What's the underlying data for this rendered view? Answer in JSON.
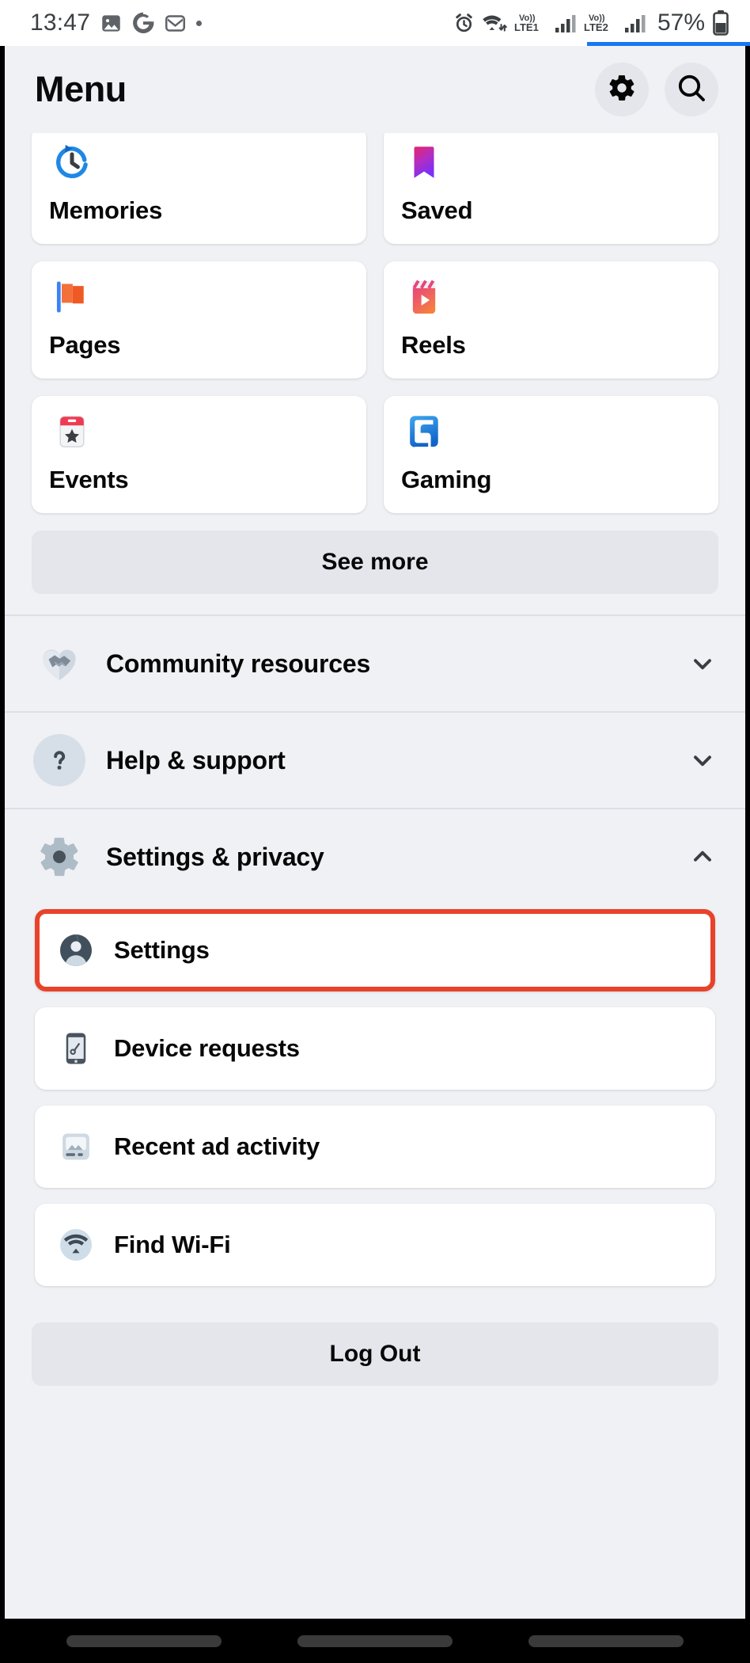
{
  "status_bar": {
    "time": "13:47",
    "left_icons": [
      "photos-icon",
      "google-icon",
      "gmail-icon",
      "dot-icon"
    ],
    "right_icons": [
      "alarm-icon",
      "wifi-icon",
      "volte1-icon",
      "signal1-icon",
      "volte2-icon",
      "signal2-icon"
    ],
    "volte1_label_top": "Vo))",
    "volte1_label_bottom": "LTE1",
    "volte2_label_top": "Vo))",
    "volte2_label_bottom": "LTE2",
    "battery_percent": "57%"
  },
  "header": {
    "title": "Menu",
    "settings_icon": "gear-icon",
    "search_icon": "search-icon"
  },
  "shortcuts": {
    "tiles": [
      {
        "label": "Memories",
        "icon": "memories-clock-icon"
      },
      {
        "label": "Saved",
        "icon": "saved-bookmark-icon"
      },
      {
        "label": "Pages",
        "icon": "pages-flag-icon"
      },
      {
        "label": "Reels",
        "icon": "reels-clapper-icon"
      },
      {
        "label": "Events",
        "icon": "events-calendar-icon"
      },
      {
        "label": "Gaming",
        "icon": "gaming-controller-icon"
      }
    ],
    "see_more_label": "See more"
  },
  "sections": [
    {
      "label": "Community resources",
      "icon": "handshake-heart-icon",
      "chevron": "chevron-down-icon",
      "expanded": false
    },
    {
      "label": "Help & support",
      "icon": "question-circle-icon",
      "chevron": "chevron-down-icon",
      "expanded": false
    },
    {
      "label": "Settings & privacy",
      "icon": "gear-gray-icon",
      "chevron": "chevron-up-icon",
      "expanded": true
    }
  ],
  "settings_privacy_items": [
    {
      "label": "Settings",
      "icon": "account-avatar-icon",
      "highlighted": true
    },
    {
      "label": "Device requests",
      "icon": "phone-key-icon",
      "highlighted": false
    },
    {
      "label": "Recent ad activity",
      "icon": "ad-activity-icon",
      "highlighted": false
    },
    {
      "label": "Find Wi-Fi",
      "icon": "wifi-circle-icon",
      "highlighted": false
    }
  ],
  "logout": {
    "label": "Log Out"
  },
  "nav_bar": {
    "buttons": [
      "recents-pill",
      "home-pill",
      "back-pill"
    ]
  },
  "colors": {
    "accent_blue": "#1877f2",
    "highlight_red": "#e8432a",
    "app_bg": "#eff1f5",
    "card_bg": "#ffffff",
    "button_bg": "#e4e6eb"
  }
}
